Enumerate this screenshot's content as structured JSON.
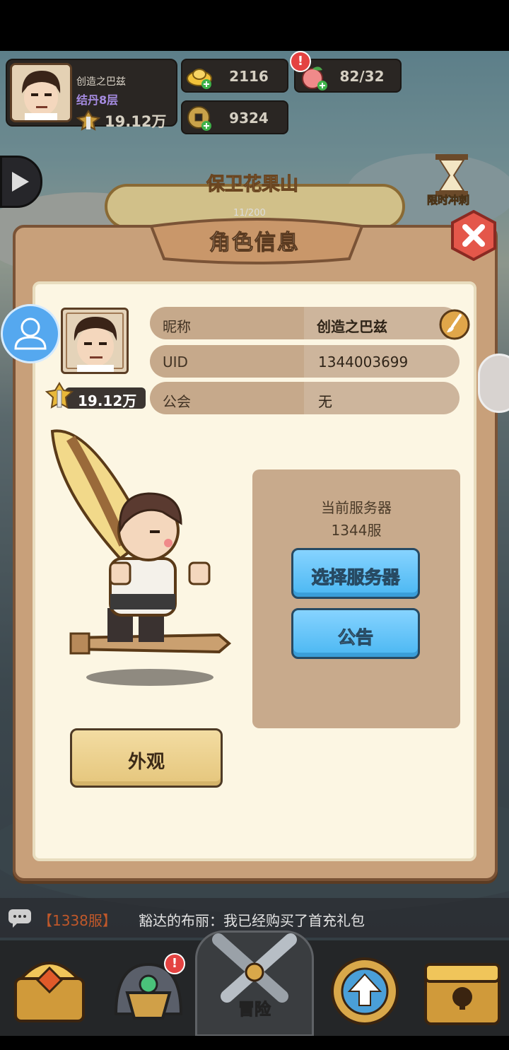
{
  "hud": {
    "player_name": "创造之巴兹",
    "realm": "结丹8层",
    "power": "19.12万",
    "gold_ingot": "2116",
    "peach": "82/32",
    "coin": "9324",
    "peach_alert": "!"
  },
  "stage": {
    "title": "保卫花果山",
    "progress": "11/200",
    "sprint_label": "限时冲刺"
  },
  "dialog": {
    "title": "角色信息",
    "power": "19.12万",
    "rows": [
      {
        "label": "昵称",
        "value": "创造之巴兹"
      },
      {
        "label": "UID",
        "value": "1344003699"
      },
      {
        "label": "公会",
        "value": "无"
      }
    ],
    "server_title": "当前服务器",
    "server_value": "1344服",
    "select_server_label": "选择服务器",
    "notice_label": "公告",
    "appearance_label": "外观"
  },
  "chat": {
    "server": "【1338服】",
    "message": "豁达的布丽：我已经购买了首充礼包"
  },
  "nav": {
    "adventure_label": "冒险",
    "alert": "!"
  },
  "colors": {
    "panel": "#c8a07a",
    "panel_inner": "#fcf6e3",
    "blue_button": "#4ab7f2",
    "gold_button": "#e5c67c",
    "chat_server": "#c0582a"
  }
}
